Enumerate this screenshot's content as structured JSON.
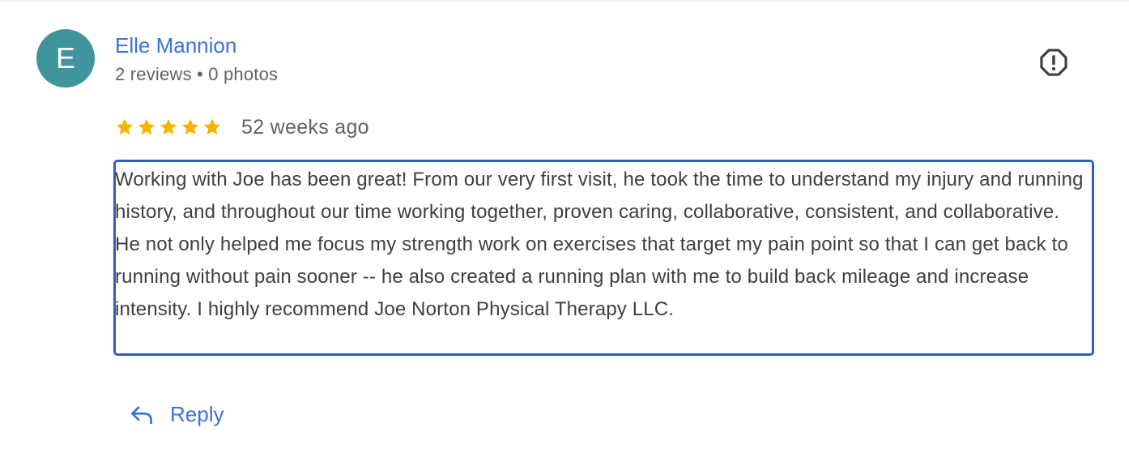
{
  "reviewer": {
    "initial": "E",
    "name": "Elle Mannion",
    "meta": "2 reviews • 0 photos",
    "avatar_color": "#3f959b"
  },
  "review": {
    "rating": 5,
    "rating_max": 5,
    "date": "52 weeks ago",
    "text": "Working with Joe has been great! From our very first visit, he took the time to understand my injury and running history, and throughout our time working together, proven caring, collaborative, consistent, and collaborative. He not only helped me focus my strength work on exercises that target my pain point so that I can get back to running without pain sooner -- he also created a running plan with me to build back mileage and increase intensity. I highly recommend Joe Norton Physical Therapy LLC."
  },
  "actions": {
    "reply_label": "Reply",
    "report_icon": "report-flag-icon",
    "reply_icon": "reply-arrow-icon"
  },
  "colors": {
    "link": "#3b73d6",
    "star": "#f4b400",
    "text": "#3c4043",
    "secondary": "#5f6368",
    "selection_border": "#2d5fbe"
  }
}
